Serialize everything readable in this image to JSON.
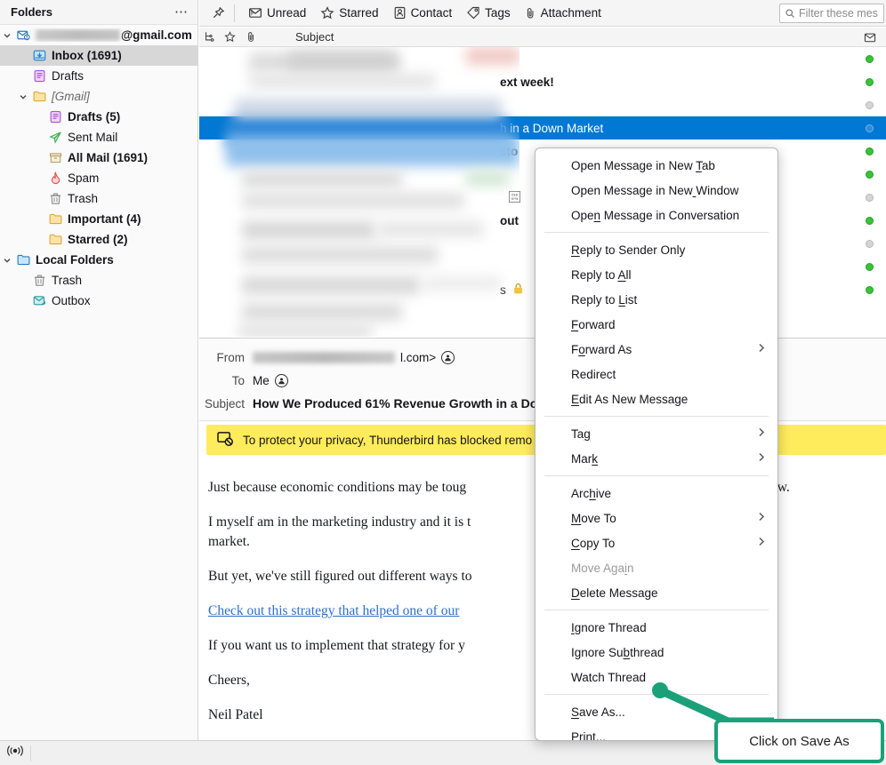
{
  "folder_pane": {
    "header_title": "Folders",
    "more_icon": "ellipsis-icon",
    "items": [
      {
        "label": "@gmail.com",
        "indent": 0,
        "bold": true,
        "icon": "account-mail-icon",
        "twisty": "down",
        "blurred_prefix": true
      },
      {
        "label": "Inbox (1691)",
        "indent": 1,
        "bold": true,
        "icon": "inbox-icon",
        "selected": true
      },
      {
        "label": "Drafts",
        "indent": 1,
        "bold": false,
        "icon": "drafts-icon"
      },
      {
        "label": "[Gmail]",
        "indent": 1,
        "bold": false,
        "icon": "folder-icon",
        "twisty": "down",
        "italic": true
      },
      {
        "label": "Drafts (5)",
        "indent": 2,
        "bold": true,
        "icon": "drafts-icon"
      },
      {
        "label": "Sent Mail",
        "indent": 2,
        "bold": false,
        "icon": "sent-icon"
      },
      {
        "label": "All Mail (1691)",
        "indent": 2,
        "bold": true,
        "icon": "archive-icon"
      },
      {
        "label": "Spam",
        "indent": 2,
        "bold": false,
        "icon": "spam-flame-icon"
      },
      {
        "label": "Trash",
        "indent": 2,
        "bold": false,
        "icon": "trash-icon"
      },
      {
        "label": "Important (4)",
        "indent": 2,
        "bold": true,
        "icon": "folder-icon"
      },
      {
        "label": "Starred (2)",
        "indent": 2,
        "bold": true,
        "icon": "folder-icon"
      },
      {
        "label": "Local Folders",
        "indent": 0,
        "bold": true,
        "icon": "local-folders-icon",
        "twisty": "down"
      },
      {
        "label": "Trash",
        "indent": 1,
        "bold": false,
        "icon": "trash-icon"
      },
      {
        "label": "Outbox",
        "indent": 1,
        "bold": false,
        "icon": "outbox-icon"
      }
    ]
  },
  "quick_filter_bar": {
    "pin_icon": "pin-icon",
    "buttons": [
      {
        "label": "Unread",
        "icon": "unread-envelope-icon"
      },
      {
        "label": "Starred",
        "icon": "star-icon"
      },
      {
        "label": "Contact",
        "icon": "contact-card-icon"
      },
      {
        "label": "Tags",
        "icon": "tag-icon"
      },
      {
        "label": "Attachment",
        "icon": "paperclip-icon"
      }
    ],
    "search_placeholder": "Filter these mes",
    "search_icon": "search-icon"
  },
  "thread_pane": {
    "columns": {
      "thread_icon": "thread-column-icon",
      "star_icon": "star-column-icon",
      "attachment_icon": "attachment-column-icon",
      "subject": "Subject",
      "unread_icon": "unread-column-icon"
    },
    "rows": [
      {
        "subject_tail": "",
        "status": "green",
        "selected": false
      },
      {
        "subject_tail": "ext week!",
        "status": "green",
        "selected": false,
        "bold": true
      },
      {
        "subject_tail": "",
        "status": "gray",
        "selected": false
      },
      {
        "subject_tail": "h in a Down Market",
        "status": "selrow",
        "selected": true
      },
      {
        "subject_tail": "sto",
        "status": "green",
        "selected": false,
        "bold": true
      },
      {
        "subject_tail": "",
        "status": "green",
        "selected": false
      },
      {
        "subject_tail": "",
        "status": "gray",
        "selected": false
      },
      {
        "subject_tail": "out",
        "status": "green",
        "selected": false,
        "bold": true
      },
      {
        "subject_tail": "",
        "status": "gray",
        "selected": false
      },
      {
        "subject_tail": "",
        "status": "green",
        "selected": false
      },
      {
        "subject_tail": "s",
        "status": "green",
        "selected": false
      }
    ]
  },
  "message_header": {
    "from_label": "From",
    "from_value_suffix": "l.com>",
    "from_blurred": true,
    "to_label": "To",
    "to_value": "Me",
    "subject_label": "Subject",
    "subject_value": "How We Produced 61% Revenue Growth in a Do",
    "contact_icon": "contact-avatar-icon"
  },
  "notification": {
    "icon": "blocked-remote-content-icon",
    "text": "To protect your privacy, Thunderbird has blocked remo",
    "background_color": "#ffec5c"
  },
  "message_body": {
    "paragraphs": [
      {
        "text": "Just because economic conditions may be toug",
        "type": "text"
      },
      {
        "text": "I myself am in the marketing industry and it is t",
        "type": "text"
      },
      {
        "text": "market.",
        "type": "text"
      },
      {
        "text": "But yet, we've still figured out different ways to",
        "type": "text"
      },
      {
        "text": "Check out this strategy that helped one of our",
        "type": "link"
      },
      {
        "text": "If you want us to implement that strategy for y",
        "type": "text"
      },
      {
        "text": "Cheers,",
        "type": "text"
      },
      {
        "text": "Neil Patel",
        "type": "text"
      }
    ],
    "right_fragment": "ow."
  },
  "context_menu": {
    "items": [
      {
        "label": "Open Message in New Tab",
        "accel_index": 20
      },
      {
        "label": "Open Message in New Window",
        "accel_index": 19
      },
      {
        "label": "Open Message in Conversation",
        "accel_index": 3
      },
      {
        "separator": true
      },
      {
        "label": "Reply to Sender Only",
        "accel_index": 0
      },
      {
        "label": "Reply to All",
        "accel_index": 9
      },
      {
        "label": "Reply to List",
        "accel_index": 9
      },
      {
        "label": "Forward",
        "accel_index": 0
      },
      {
        "label": "Forward As",
        "accel_index": 1,
        "submenu": true
      },
      {
        "label": "Redirect",
        "accel_index": -1
      },
      {
        "label": "Edit As New Message",
        "accel_index": 0
      },
      {
        "separator": true
      },
      {
        "label": "Tag",
        "accel_index": 2,
        "submenu": true
      },
      {
        "label": "Mark",
        "accel_index": 3,
        "submenu": true
      },
      {
        "separator": true
      },
      {
        "label": "Archive",
        "accel_index": 3
      },
      {
        "label": "Move To",
        "accel_index": 0,
        "submenu": true
      },
      {
        "label": "Copy To",
        "accel_index": 0,
        "submenu": true
      },
      {
        "label": "Move Again",
        "accel_index": 8,
        "disabled": true
      },
      {
        "label": "Delete Message",
        "accel_index": 0
      },
      {
        "separator": true
      },
      {
        "label": "Ignore Thread",
        "accel_index": 0
      },
      {
        "label": "Ignore Subthread",
        "accel_index": 9
      },
      {
        "label": "Watch Thread",
        "accel_index": -1
      },
      {
        "separator": true
      },
      {
        "label": "Save As...",
        "accel_index": 0
      },
      {
        "label": "Print...",
        "accel_index": 0
      }
    ]
  },
  "annotation": {
    "callout_text": "Click on Save As",
    "accent_color": "#1aa179"
  },
  "status_bar": {
    "connectivity_icon": "connectivity-icon"
  }
}
